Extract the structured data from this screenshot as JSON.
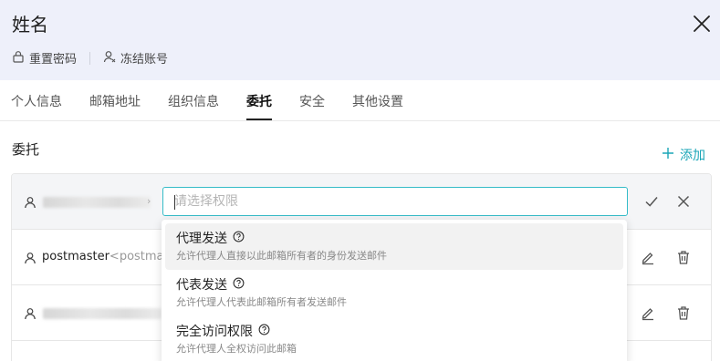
{
  "header": {
    "title": "姓名",
    "actions": [
      {
        "label": "重置密码",
        "icon": "lock-icon"
      },
      {
        "label": "冻结账号",
        "icon": "user-freeze-icon"
      }
    ]
  },
  "tabs": [
    {
      "label": "个人信息",
      "active": false
    },
    {
      "label": "邮箱地址",
      "active": false
    },
    {
      "label": "组织信息",
      "active": false
    },
    {
      "label": "委托",
      "active": true
    },
    {
      "label": "安全",
      "active": false
    },
    {
      "label": "其他设置",
      "active": false
    }
  ],
  "section": {
    "title": "委托",
    "add_label": "添加"
  },
  "editing_row": {
    "placeholder": "请选择权限",
    "value": ""
  },
  "rows": [
    {
      "name": "postmaster",
      "email": "<postmaster"
    }
  ],
  "dropdown": {
    "options": [
      {
        "label": "代理发送",
        "desc": "允许代理人直接以此邮箱所有者的身份发送邮件",
        "highlighted": true
      },
      {
        "label": "代表发送",
        "desc": "允许代理人代表此邮箱所有者发送邮件",
        "highlighted": false
      },
      {
        "label": "完全访问权限",
        "desc": "允许代理人全权访问此邮箱",
        "highlighted": false
      }
    ]
  },
  "colors": {
    "accent": "#1aa6b7",
    "header_bg": "#eef0fa",
    "input_border": "#35bcc8"
  }
}
